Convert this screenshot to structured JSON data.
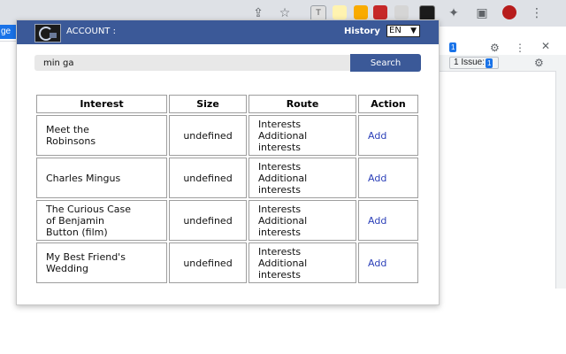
{
  "browser": {
    "page_chip_label": "ge",
    "devtools": {
      "issues_count_top": "1",
      "issues_label": "1 Issue:",
      "issues_count": "1"
    }
  },
  "header": {
    "account_label": "ACCOUNT :",
    "history_label": "History",
    "language_selected": "EN"
  },
  "search": {
    "query": "min ga",
    "button_label": "Search"
  },
  "table": {
    "columns": [
      "Interest",
      "Size",
      "Route",
      "Action"
    ],
    "rows": [
      {
        "interest_lines": [
          "Meet the",
          "Robinsons"
        ],
        "size": "undefined",
        "route_lines": [
          "Interests",
          "Additional",
          "interests"
        ],
        "action": "Add"
      },
      {
        "interest_lines": [
          "Charles Mingus"
        ],
        "size": "undefined",
        "route_lines": [
          "Interests",
          "Additional",
          "interests"
        ],
        "action": "Add"
      },
      {
        "interest_lines": [
          "The Curious Case",
          "of Benjamin",
          "Button (film)"
        ],
        "size": "undefined",
        "route_lines": [
          "Interests",
          "Additional",
          "interests"
        ],
        "action": "Add"
      },
      {
        "interest_lines": [
          "My Best Friend's",
          "Wedding"
        ],
        "size": "undefined",
        "route_lines": [
          "Interests",
          "Additional",
          "interests"
        ],
        "action": "Add"
      }
    ]
  },
  "colors": {
    "header_bg": "#3b5998",
    "search_button_bg": "#3b5998",
    "add_link": "#2b3fb8"
  },
  "icons": [
    "share-icon",
    "star-icon",
    "extension-icon",
    "puzzle-icon",
    "sidebar-icon",
    "profile-icon",
    "kebab-menu-icon",
    "gear-icon",
    "close-icon"
  ]
}
